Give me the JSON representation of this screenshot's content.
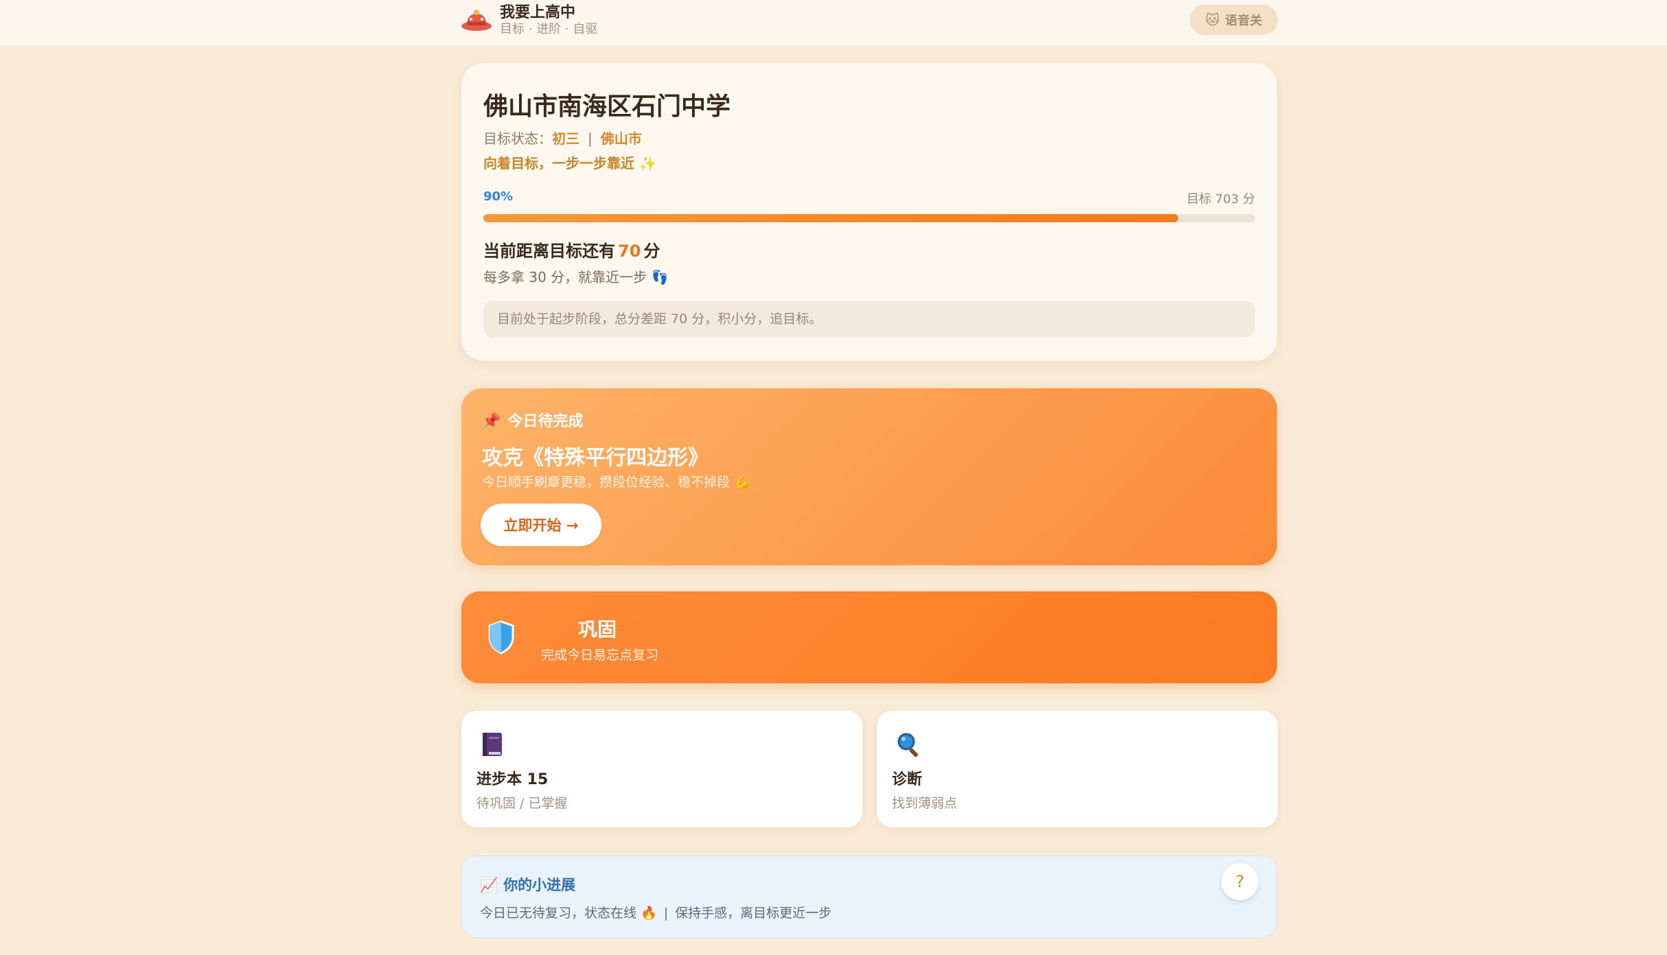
{
  "header": {
    "title": "我要上高中",
    "subtitle": "目标 · 进阶 · 自驱",
    "voice_label": "语音关",
    "voice_icon": "cat-face-icon"
  },
  "goal_card": {
    "school": "佛山市南海区石门中学",
    "status_prefix": "目标状态：",
    "grade": "初三",
    "separator": "|",
    "city": "佛山市",
    "motto": "向着目标，一步一步靠近 ✨",
    "progress_label": "90%",
    "progress_fraction": 0.9,
    "target_label": "目标 703 分",
    "gap_prefix": "当前距离目标还有",
    "gap_value": "70",
    "gap_suffix": "分",
    "step_text": "每多拿 30 分，就靠近一步 👣",
    "note": "目前处于起步阶段，总分差距 70 分，积小分，追目标。"
  },
  "today_card": {
    "label": "今日待完成",
    "pin_icon": "📌",
    "title": "攻克《特殊平行四边形》",
    "subtitle": "今日顺手刷章更稳，攒段位经验、稳不掉段 💪",
    "button_label": "立即开始 →"
  },
  "consolidate_card": {
    "title": "巩固",
    "subtitle": "完成今日易忘点复习"
  },
  "mini_cards": [
    {
      "title": "进步本 15",
      "subtitle": "待巩固 / 已掌握",
      "icon": "notebook-icon"
    },
    {
      "title": "诊断",
      "subtitle": "找到薄弱点",
      "icon": "magnifier-icon"
    }
  ],
  "progress_card": {
    "title": "你的小进展",
    "icon": "📈",
    "text_left": "今日已无待复习，状态在线 🔥",
    "separator": "|",
    "text_right": "保持手感，离目标更近一步",
    "help_label": "?"
  },
  "colors": {
    "accent_orange": "#fc7a22",
    "progress_blue": "#2f86d6",
    "background": "#f9ead6"
  }
}
